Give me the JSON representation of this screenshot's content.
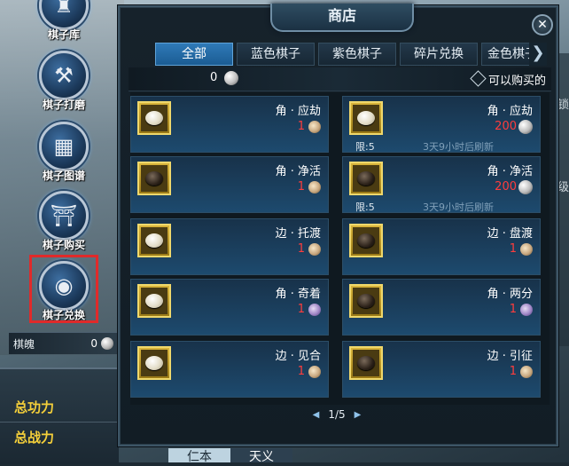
{
  "sidebar": {
    "items": [
      {
        "label": "棋子库",
        "icon": "chess-library-icon"
      },
      {
        "label": "棋子打磨",
        "icon": "hammer-icon"
      },
      {
        "label": "棋子图谱",
        "icon": "grid-icon"
      },
      {
        "label": "棋子购买",
        "icon": "shop-stall-icon"
      },
      {
        "label": "棋子兑换",
        "icon": "exchange-icon"
      }
    ],
    "soul_label": "棋魄",
    "soul_value": "0",
    "total_merit": "总功力",
    "total_power": "总战力",
    "bottom_tabs": [
      "仁本",
      "天义"
    ]
  },
  "shop": {
    "title": "商店",
    "close": "✕",
    "tabs": [
      "全部",
      "蓝色棋子",
      "紫色棋子",
      "碎片兑换",
      "金色棋子"
    ],
    "tab_arrow": "❯",
    "currency_value": "0",
    "filter_label": "可以购买的",
    "items": [
      {
        "name": "角 · 应劫",
        "price": "1",
        "currency": "bronze",
        "stone": "white"
      },
      {
        "name": "角 · 应劫",
        "price": "200",
        "currency": "silver",
        "stone": "white",
        "limit": "限:5",
        "refresh": "3天9小时后刷新"
      },
      {
        "name": "角 · 净活",
        "price": "1",
        "currency": "bronze",
        "stone": "black"
      },
      {
        "name": "角 · 净活",
        "price": "200",
        "currency": "silver",
        "stone": "black",
        "limit": "限:5",
        "refresh": "3天9小时后刷新"
      },
      {
        "name": "边 · 托渡",
        "price": "1",
        "currency": "bronze",
        "stone": "white"
      },
      {
        "name": "边 · 盘渡",
        "price": "1",
        "currency": "bronze",
        "stone": "black"
      },
      {
        "name": "角 · 奇着",
        "price": "1",
        "currency": "purple",
        "stone": "white"
      },
      {
        "name": "角 · 两分",
        "price": "1",
        "currency": "purple",
        "stone": "black"
      },
      {
        "name": "边 · 见合",
        "price": "1",
        "currency": "bronze",
        "stone": "white"
      },
      {
        "name": "边 · 引征",
        "price": "1",
        "currency": "bronze",
        "stone": "black"
      }
    ],
    "pager": {
      "prev": "◀",
      "page": "1/5",
      "next": "▶"
    }
  },
  "background": {
    "right_text_1": "锁",
    "right_text_2": "级"
  },
  "colors": {
    "active_tab": "#1b5c93",
    "price_red": "#ff3d3d",
    "stat_gold": "#f5d03a",
    "highlight_red": "#e02a2a"
  }
}
